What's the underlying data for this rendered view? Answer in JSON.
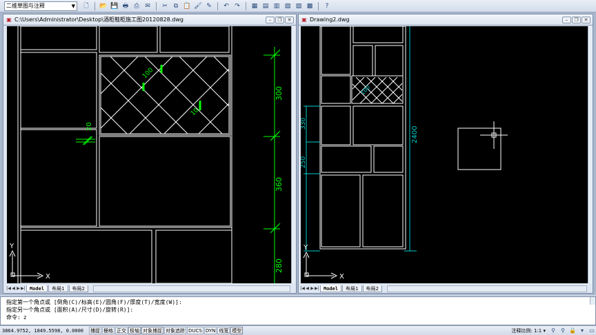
{
  "toolbar": {
    "workspace": "二维草图与注释",
    "tools": [
      {
        "icon": "new-file-icon",
        "glyph": "🗋"
      },
      {
        "icon": "open-folder-icon",
        "glyph": "📂"
      },
      {
        "icon": "save-icon",
        "glyph": "💾"
      },
      {
        "icon": "print-icon",
        "glyph": "🖶"
      },
      {
        "icon": "plot-preview-icon",
        "glyph": "⎙"
      },
      {
        "icon": "publish-icon",
        "glyph": "✉"
      },
      {
        "icon": "cut-icon",
        "glyph": "✂"
      },
      {
        "icon": "copy-icon",
        "glyph": "⧉"
      },
      {
        "icon": "paste-icon",
        "glyph": "📋"
      },
      {
        "icon": "match-properties-icon",
        "glyph": "🖌"
      },
      {
        "icon": "block-editor-icon",
        "glyph": "✎"
      },
      {
        "icon": "undo-icon",
        "glyph": "↶"
      },
      {
        "icon": "redo-icon",
        "glyph": "↷"
      },
      {
        "icon": "properties-icon",
        "glyph": "▦"
      },
      {
        "icon": "design-center-icon",
        "glyph": "▤"
      },
      {
        "icon": "tool-palettes-icon",
        "glyph": "▥"
      },
      {
        "icon": "sheet-set-icon",
        "glyph": "▧"
      },
      {
        "icon": "markup-icon",
        "glyph": "▨"
      },
      {
        "icon": "calculator-icon",
        "glyph": "▩"
      },
      {
        "icon": "help-icon",
        "glyph": "?"
      }
    ]
  },
  "left_doc": {
    "title": "C:\\Users\\Administrator\\Desktop\\酒柜鞋柜施工图20120828.dwg",
    "dims": {
      "d300": "300",
      "d360": "360",
      "d280": "280",
      "d100": "100",
      "d10": "10",
      "d20": "20"
    },
    "ucs_y": "Y",
    "ucs_x": "X",
    "tabs": [
      "Model",
      "布局1",
      "布局2"
    ]
  },
  "right_doc": {
    "title": "Drawing2.dwg",
    "dims": {
      "d2400": "2400",
      "d330": "330",
      "d250": "250",
      "d100": "100"
    },
    "ucs_y": "Y",
    "ucs_x": "X",
    "tabs": [
      "Model",
      "布局1",
      "布局2"
    ]
  },
  "window_buttons": {
    "min": "–",
    "restore": "❐",
    "close": "✕"
  },
  "command": {
    "line1": "指定第一个角点或 [倒角(C)/标高(E)/圆角(F)/厚度(T)/宽度(W)]:",
    "line2": "指定另一个角点或 [面积(A)/尺寸(D)/旋转(R)]:",
    "prompt": "命令:",
    "value": "z"
  },
  "status": {
    "coords": "3864.9752, 1849.5598, 0.0000",
    "toggles": [
      {
        "label": "捕捉",
        "on": false
      },
      {
        "label": "栅格",
        "on": false
      },
      {
        "label": "正交",
        "on": false
      },
      {
        "label": "极轴",
        "on": true
      },
      {
        "label": "对象捕捉",
        "on": true
      },
      {
        "label": "对象追踪",
        "on": false
      },
      {
        "label": "DUCS",
        "on": false
      },
      {
        "label": "DYN",
        "on": false
      },
      {
        "label": "线宽",
        "on": false
      },
      {
        "label": "模型",
        "on": true
      }
    ],
    "scale_label": "注释比例: 1:1 ▾"
  },
  "colors": {
    "canvas": "#000000",
    "geometry": "#ffffff",
    "dimension": "#00ff00",
    "dimension_right": "#00cccc"
  }
}
